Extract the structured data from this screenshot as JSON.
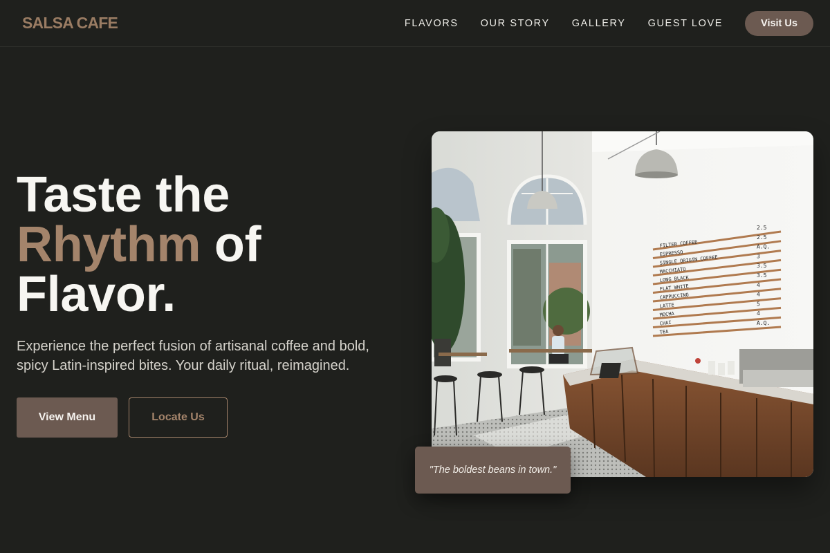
{
  "brand": {
    "name": "SALSA CAFE"
  },
  "nav": {
    "links": [
      "FLAVORS",
      "OUR STORY",
      "GALLERY",
      "GUEST LOVE"
    ],
    "cta": "Visit Us"
  },
  "hero": {
    "title_line1": "Taste the",
    "title_accent": "Rhythm",
    "title_line2_rest": " of",
    "title_line3": "Flavor.",
    "subtitle": "Experience the perfect fusion of artisanal coffee and bold, spicy Latin-inspired bites. Your daily ritual, reimagined.",
    "primary_button": "View Menu",
    "secondary_button": "Locate Us"
  },
  "image": {
    "menu_board": [
      {
        "item": "FILTER COFFEE",
        "price": "2.5"
      },
      {
        "item": "ESPRESSO",
        "price": "2.5"
      },
      {
        "item": "SINGLE ORIGIN COFFEE",
        "price": "A.Q."
      },
      {
        "item": "MACCHIATO",
        "price": "3"
      },
      {
        "item": "LONG BLACK",
        "price": "3.5"
      },
      {
        "item": "FLAT WHITE",
        "price": "3.5"
      },
      {
        "item": "CAPPUCCINO",
        "price": "4"
      },
      {
        "item": "LATTE",
        "price": "4"
      },
      {
        "item": "MOCHA",
        "price": "5"
      },
      {
        "item": "CHAI",
        "price": "4"
      },
      {
        "item": "TEA",
        "price": "A.Q."
      }
    ]
  },
  "quote": {
    "text": "\"The boldest beans in town.\""
  },
  "colors": {
    "background": "#1f201d",
    "accent": "#a4846b",
    "button": "#6c5a51",
    "text": "#f7f6f2"
  }
}
